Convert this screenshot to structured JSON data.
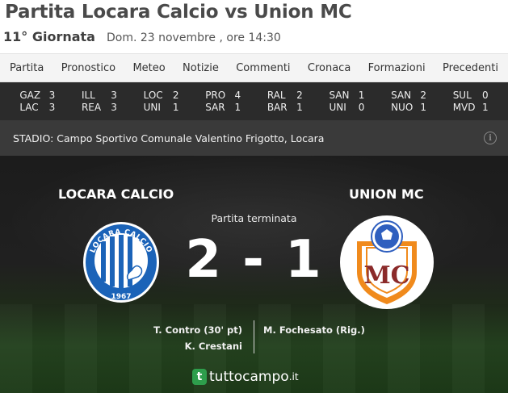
{
  "header": {
    "title": "Partita Locara Calcio vs Union MC",
    "round": "11° Giornata",
    "datetime": "Dom. 23 novembre , ore 14:30"
  },
  "tabs": [
    "Partita",
    "Pronostico",
    "Meteo",
    "Notizie",
    "Commenti",
    "Cronaca",
    "Formazioni",
    "Precedenti"
  ],
  "other_results": [
    {
      "home": "GAZ",
      "home_score": "3",
      "away": "LAC",
      "away_score": "3"
    },
    {
      "home": "ILL",
      "home_score": "3",
      "away": "REA",
      "away_score": "3"
    },
    {
      "home": "LOC",
      "home_score": "2",
      "away": "UNI",
      "away_score": "1"
    },
    {
      "home": "PRO",
      "home_score": "4",
      "away": "SAR",
      "away_score": "1"
    },
    {
      "home": "RAL",
      "home_score": "2",
      "away": "BAR",
      "away_score": "1"
    },
    {
      "home": "SAN",
      "home_score": "1",
      "away": "UNI",
      "away_score": "0"
    },
    {
      "home": "SAN",
      "home_score": "2",
      "away": "NUO",
      "away_score": "1"
    },
    {
      "home": "SUL",
      "home_score": "0",
      "away": "MVD",
      "away_score": "1"
    }
  ],
  "stadium": {
    "text": "STADIO: Campo Sportivo Comunale Valentino Frigotto, Locara",
    "icon": "info-icon"
  },
  "match": {
    "home_team": "LOCARA CALCIO",
    "away_team": "UNION MC",
    "status": "Partita terminata",
    "score": "2 - 1",
    "home_scorers": [
      "T. Contro (30' pt)",
      "K. Crestani"
    ],
    "away_scorers": [
      "M. Fochesato (Rig.)"
    ],
    "home_crest_text": "LOCARA CALCIO",
    "home_crest_year": "1967",
    "away_crest_text": "MC"
  },
  "brand": {
    "mark": "t",
    "name": "tuttocampo",
    "tld": ".it",
    "green": "#2e9e4c"
  }
}
